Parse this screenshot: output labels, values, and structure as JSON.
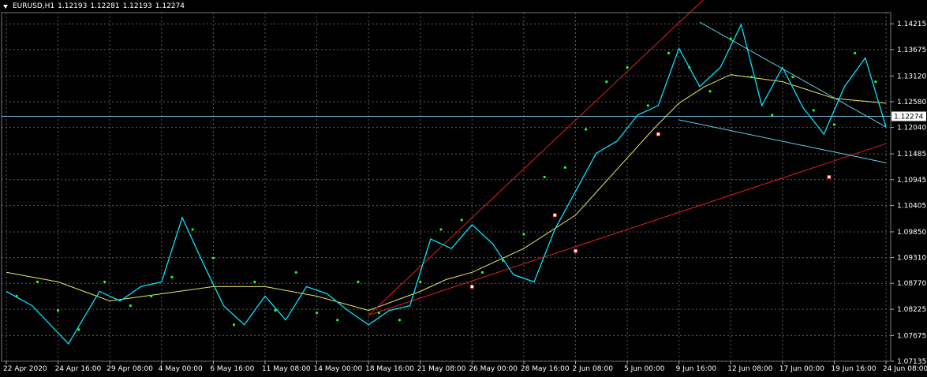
{
  "header": {
    "symbol": "EURUSD,H1",
    "open": "1.12193",
    "high": "1.12281",
    "low": "1.12193",
    "close": "1.12274"
  },
  "colors": {
    "background": "#000000",
    "grid": "#5c5c5c",
    "price_line": "#00e5ff",
    "price_line_alt": "#ffffff",
    "psar": "#22ff22",
    "ma": "#e8e86a",
    "trend_red": "#e02020",
    "channel": "#5fd0e8",
    "bid_line": "#6fb5d8",
    "text": "#ffffff"
  },
  "chart_data": {
    "type": "line",
    "title": "EURUSD,H1",
    "y_axis_ticks": [
      "1.14215",
      "1.13675",
      "1.13120",
      "1.12580",
      "1.12040",
      "1.11485",
      "1.10945",
      "1.10405",
      "1.09850",
      "1.09310",
      "1.08770",
      "1.08225",
      "1.07675",
      "1.07135"
    ],
    "ylim": [
      1.07135,
      1.1445
    ],
    "current_price_label": "1.12274",
    "current_price": 1.12274,
    "x_axis_labels": [
      "22 Apr 2020",
      "24 Apr 16:00",
      "29 Apr 08:00",
      "4 May 00:00",
      "6 May 16:00",
      "11 May 08:00",
      "14 May 00:00",
      "18 May 16:00",
      "21 May 08:00",
      "26 May 00:00",
      "28 May 16:00",
      "2 Jun 08:00",
      "5 Jun 00:00",
      "9 Jun 16:00",
      "12 Jun 08:00",
      "17 Jun 00:00",
      "19 Jun 16:00",
      "24 Jun 08:00"
    ],
    "grid": true,
    "series": [
      {
        "kind": "price",
        "x": [
          0,
          0.5,
          1.2,
          1.8,
          2.2,
          2.6,
          3.0,
          3.4,
          3.8,
          4.2,
          4.6,
          5.0,
          5.4,
          5.8,
          6.2,
          6.6,
          7.0,
          7.4,
          7.8,
          8.2,
          8.6,
          9.0,
          9.4,
          9.8,
          10.2,
          10.6,
          11.0,
          11.4,
          11.8,
          12.2,
          12.6,
          13.0,
          13.4,
          13.8,
          14.2,
          14.6,
          15.0,
          15.4,
          15.8,
          16.2,
          16.6,
          17.0
        ],
        "values": [
          1.086,
          1.083,
          1.075,
          1.086,
          1.084,
          1.087,
          1.088,
          1.1015,
          1.092,
          1.083,
          1.079,
          1.085,
          1.08,
          1.087,
          1.0855,
          1.082,
          1.079,
          1.082,
          1.083,
          1.097,
          1.095,
          1.1,
          1.096,
          1.0895,
          1.088,
          1.099,
          1.107,
          1.115,
          1.1175,
          1.123,
          1.125,
          1.137,
          1.129,
          1.133,
          1.142,
          1.125,
          1.133,
          1.1245,
          1.119,
          1.129,
          1.135,
          1.1205
        ]
      },
      {
        "kind": "moving_average",
        "x": [
          0,
          1,
          2,
          3,
          4,
          5,
          6,
          7,
          8,
          8.5,
          9,
          10,
          11,
          12,
          12.5,
          13,
          13.5,
          14,
          15,
          16,
          17
        ],
        "values": [
          1.09,
          1.088,
          1.084,
          1.0855,
          1.087,
          1.087,
          1.085,
          1.082,
          1.086,
          1.0885,
          1.09,
          1.095,
          1.102,
          1.114,
          1.12,
          1.1255,
          1.129,
          1.1315,
          1.13,
          1.1265,
          1.1255
        ]
      }
    ],
    "psar_x": [
      0.2,
      0.6,
      1.0,
      1.4,
      1.9,
      2.4,
      2.8,
      3.2,
      3.6,
      4.0,
      4.4,
      4.8,
      5.2,
      5.6,
      6.0,
      6.4,
      6.8,
      7.2,
      7.6,
      8.0,
      8.4,
      8.8,
      9.2,
      9.6,
      10.0,
      10.4,
      10.8,
      11.2,
      11.6,
      12.0,
      12.4,
      12.8,
      13.2,
      13.6,
      14.0,
      14.4,
      14.8,
      15.2,
      15.6,
      16.0,
      16.4,
      16.8
    ],
    "psar_values": [
      1.085,
      1.088,
      1.082,
      1.078,
      1.088,
      1.083,
      1.085,
      1.089,
      1.099,
      1.093,
      1.079,
      1.088,
      1.082,
      1.09,
      1.0815,
      1.08,
      1.088,
      1.0815,
      1.08,
      1.088,
      1.099,
      1.101,
      1.09,
      1.0925,
      1.098,
      1.11,
      1.112,
      1.12,
      1.13,
      1.133,
      1.125,
      1.136,
      1.133,
      1.128,
      1.139,
      1.131,
      1.123,
      1.131,
      1.124,
      1.121,
      1.136,
      1.13
    ],
    "annotations": [
      {
        "kind": "trendline",
        "color": "red",
        "x": [
          7.0,
          13.5
        ],
        "values": [
          1.081,
          1.1475
        ]
      },
      {
        "kind": "trendline",
        "color": "red",
        "x": [
          7.0,
          17.0
        ],
        "values": [
          1.081,
          1.117
        ]
      },
      {
        "kind": "trendline",
        "color": "cyan",
        "x": [
          13.4,
          17.0
        ],
        "values": [
          1.1425,
          1.1205
        ]
      },
      {
        "kind": "trendline",
        "color": "cyan",
        "x": [
          13.0,
          17.0
        ],
        "values": [
          1.122,
          1.113
        ]
      },
      {
        "kind": "marker",
        "x": 9.0,
        "value": 1.087
      },
      {
        "kind": "marker",
        "x": 10.6,
        "value": 1.102
      },
      {
        "kind": "marker",
        "x": 11.0,
        "value": 1.0945
      },
      {
        "kind": "marker",
        "x": 12.6,
        "value": 1.119
      },
      {
        "kind": "marker",
        "x": 15.9,
        "value": 1.11
      }
    ]
  }
}
